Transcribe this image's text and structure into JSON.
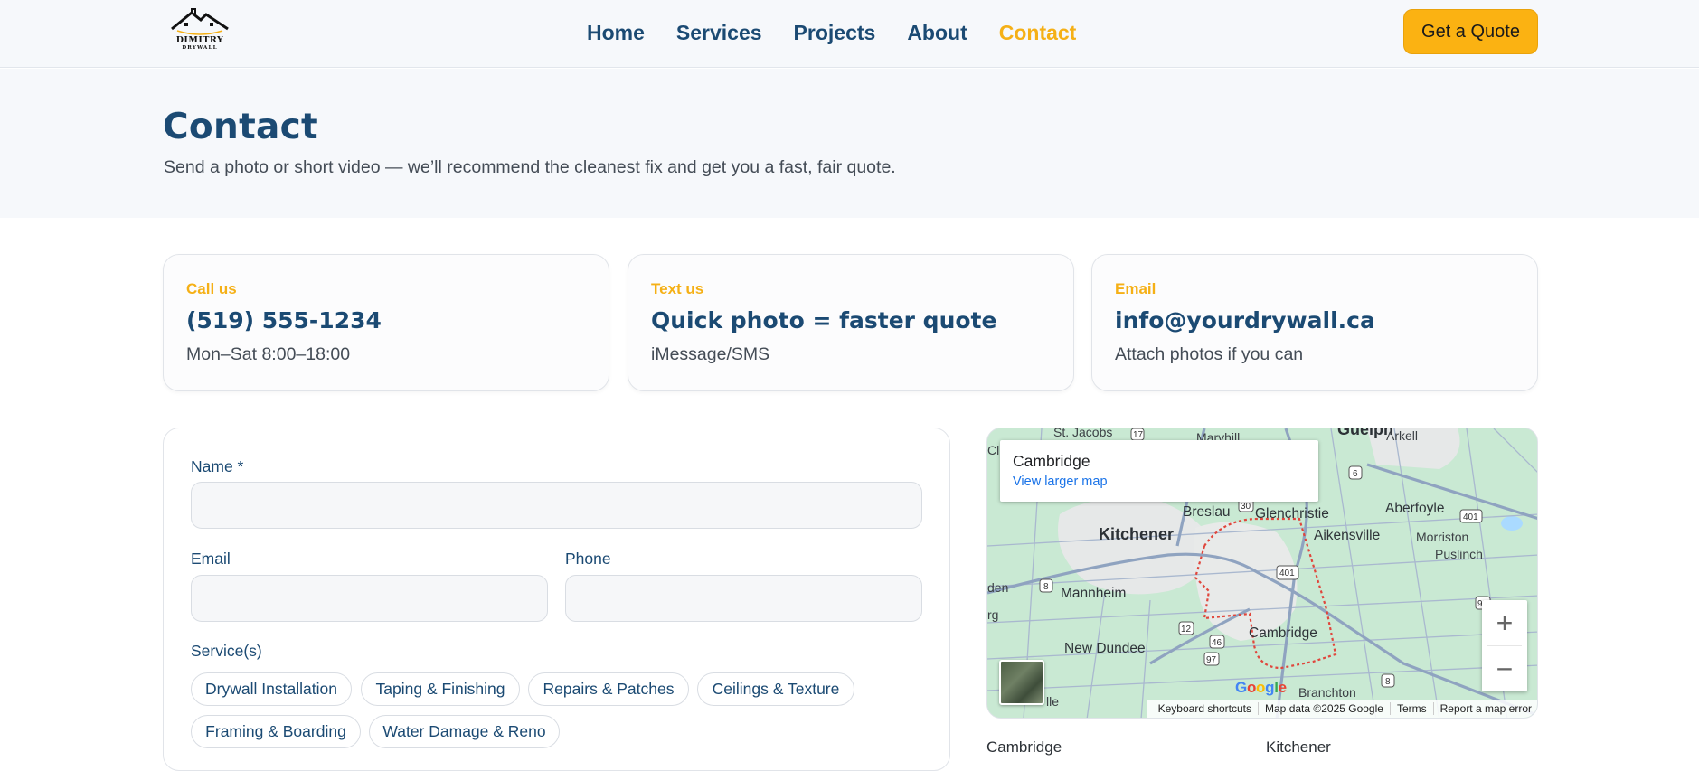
{
  "header": {
    "logo": {
      "line1": "DIMITRY",
      "line2": "DRYWALL"
    },
    "nav": [
      {
        "label": "Home",
        "active": false
      },
      {
        "label": "Services",
        "active": false
      },
      {
        "label": "Projects",
        "active": false
      },
      {
        "label": "About",
        "active": false
      },
      {
        "label": "Contact",
        "active": true
      }
    ],
    "cta_label": "Get a Quote"
  },
  "hero": {
    "title": "Contact",
    "subtitle": "Send a photo or short video — we’ll recommend the cleanest fix and get you a fast, fair quote."
  },
  "cards": [
    {
      "kicker": "Call us",
      "value": "(519) 555-1234",
      "sub": "Mon–Sat 8:00–18:00"
    },
    {
      "kicker": "Text us",
      "value": "Quick photo = faster quote",
      "sub": "iMessage/SMS"
    },
    {
      "kicker": "Email",
      "value": "info@yourdrywall.ca",
      "sub": "Attach photos if you can"
    }
  ],
  "form": {
    "name_label": "Name *",
    "name_value": "",
    "email_label": "Email",
    "email_value": "",
    "phone_label": "Phone",
    "phone_value": "",
    "services_label": "Service(s)",
    "services": [
      "Drywall Installation",
      "Taping & Finishing",
      "Repairs & Patches",
      "Ceilings & Texture",
      "Framing & Boarding",
      "Water Damage & Reno"
    ]
  },
  "map": {
    "info_title": "Cambridge",
    "info_link": "View larger map",
    "place_labels": {
      "st_jacobs": "St. Jacobs",
      "maryhill": "Maryhill",
      "guelph": "Guelph",
      "arkell": "Arkell",
      "breslau": "Breslau",
      "glenchristie": "Glenchristie",
      "aberfoyle": "Aberfoyle",
      "kitchener": "Kitchener",
      "aikensville": "Aikensville",
      "morriston": "Morriston",
      "puslinch": "Puslinch",
      "mannheim": "Mannheim",
      "cambridge": "Cambridge",
      "new_dundee": "New Dundee",
      "branchton": "Branchton",
      "edge_cl": "Cl",
      "edge_den": "den",
      "edge_rg": "rg",
      "edge_lle": "lle"
    },
    "route_shields": [
      "17",
      "6",
      "30",
      "401",
      "401",
      "8",
      "12",
      "46",
      "97",
      "8",
      "97"
    ],
    "google_logo": "Google",
    "attribution": [
      "Keyboard shortcuts",
      "Map data ©2025 Google",
      "Terms",
      "Report a map error"
    ],
    "zoom_in": "+",
    "zoom_out": "−",
    "colors": {
      "land": "#c9e9d3",
      "urban": "#e8eaea",
      "road": "#8fa3c0",
      "highway": "#9aa9c4",
      "boundary": "#e0463c"
    }
  },
  "below_map": {
    "left": "Cambridge",
    "right": "Kitchener"
  }
}
